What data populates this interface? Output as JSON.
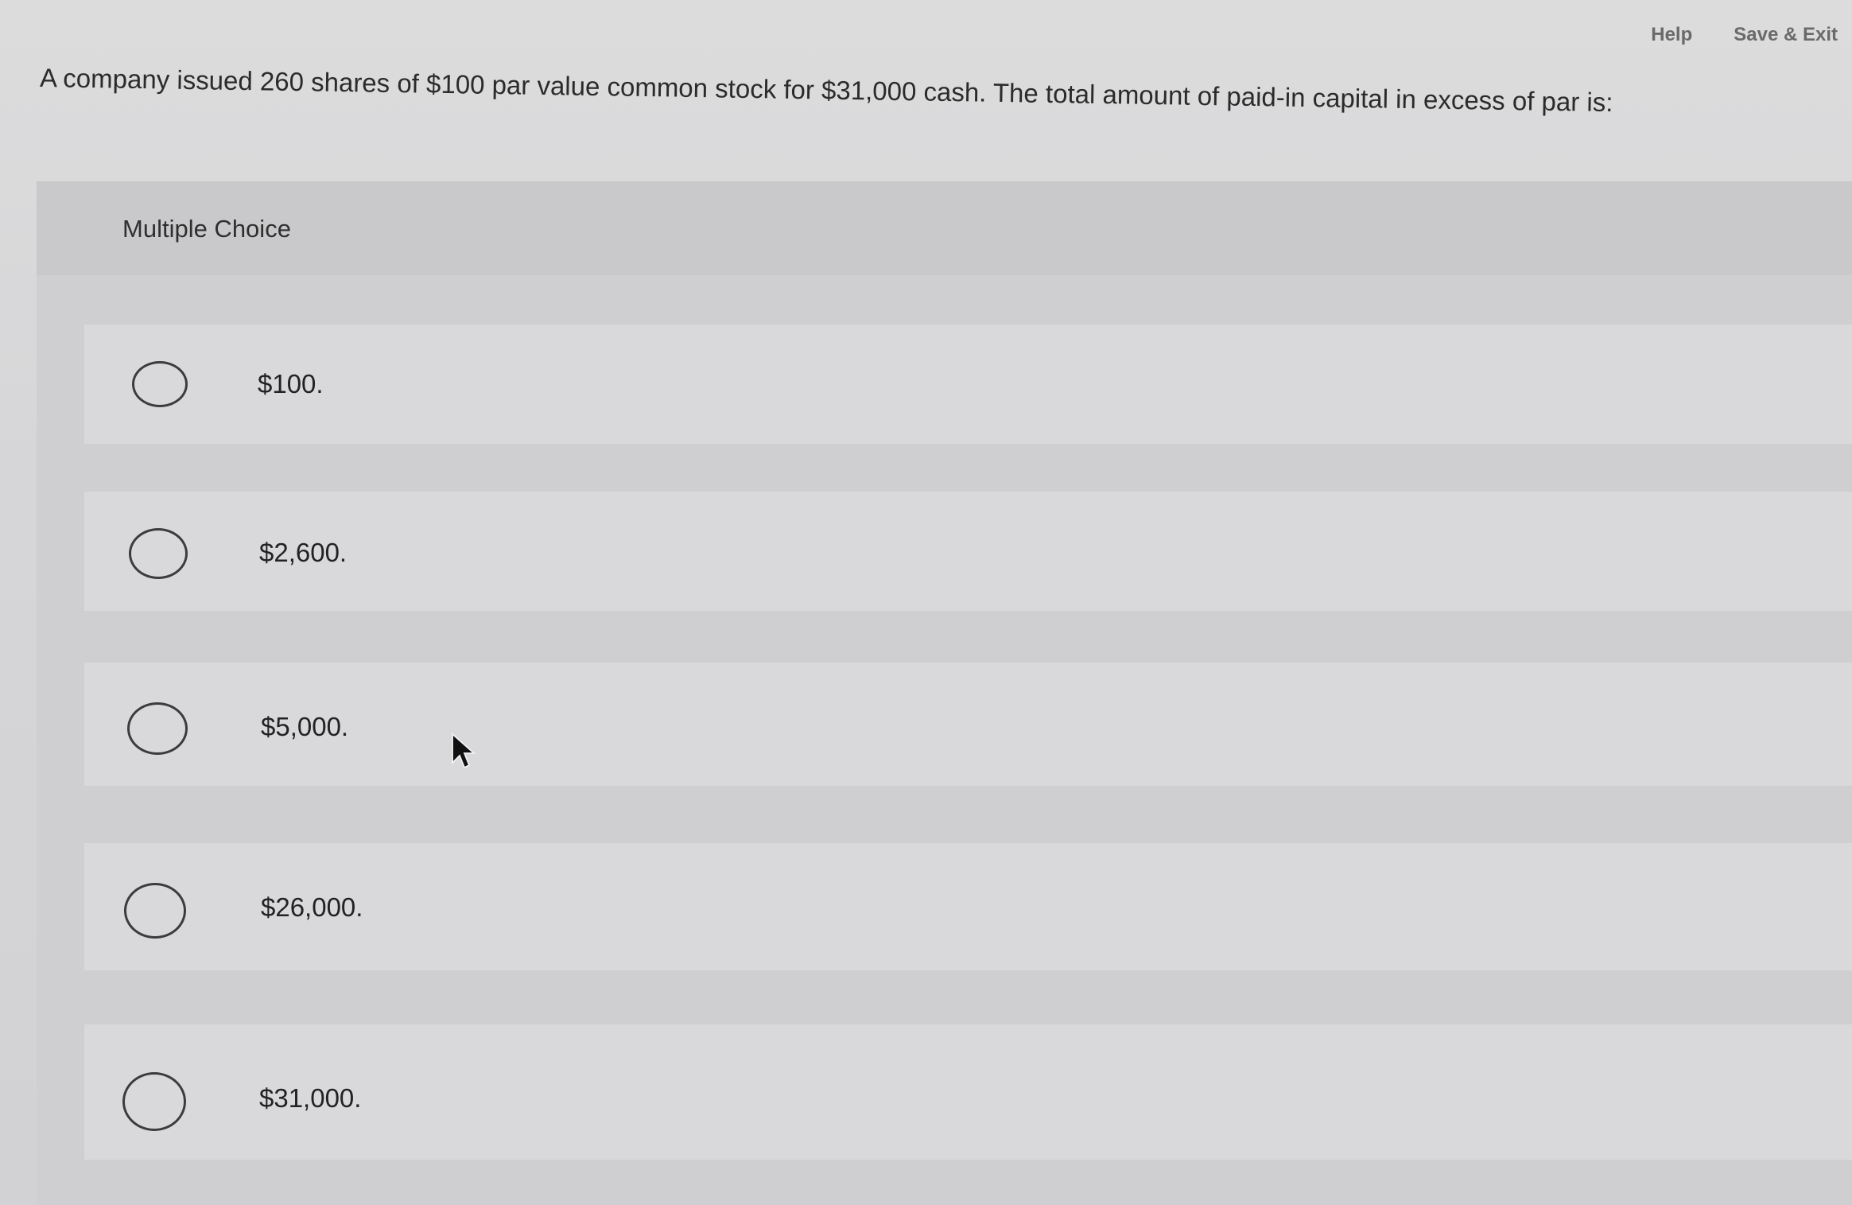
{
  "header": {
    "help_label": "Help",
    "save_exit_label": "Save & Exit"
  },
  "question": {
    "text": "A company issued 260 shares of $100 par value common stock for $31,000 cash. The total amount of paid-in capital in excess of par is:"
  },
  "multiple_choice": {
    "title": "Multiple Choice",
    "options": [
      {
        "label": "$100."
      },
      {
        "label": "$2,600."
      },
      {
        "label": "$5,000."
      },
      {
        "label": "$26,000."
      },
      {
        "label": "$31,000."
      }
    ]
  },
  "colors": {
    "background": "#d6d6d8",
    "option_background": "#d9d9db",
    "text": "#2b2b2b"
  }
}
